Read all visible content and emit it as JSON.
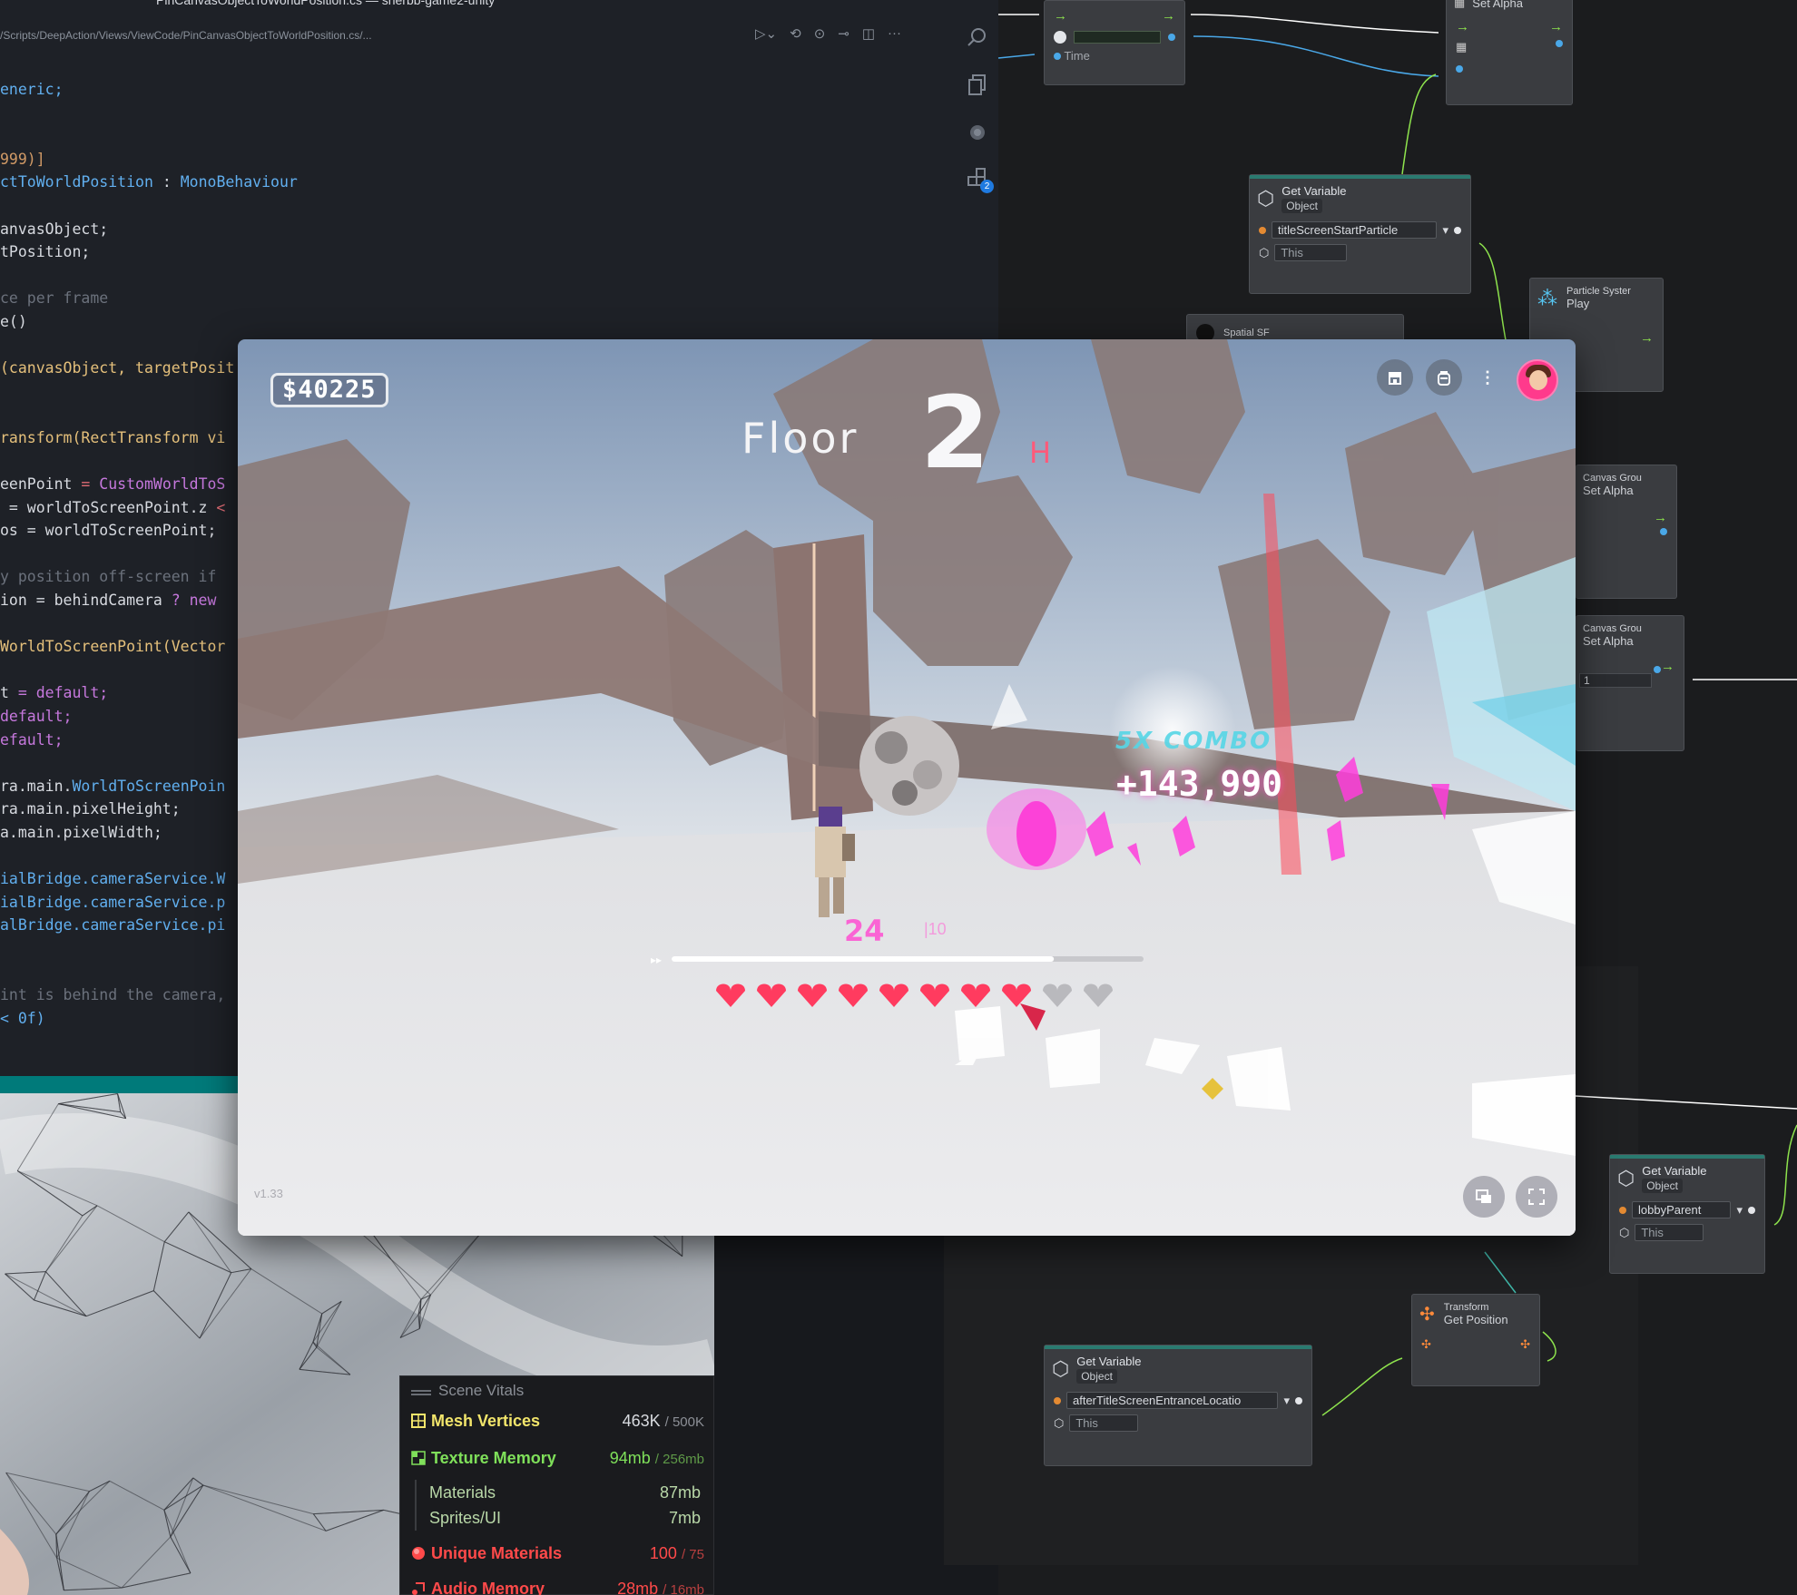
{
  "editor": {
    "title": "PinCanvasObjectToWorldPosition.cs — sherbb-game2-unity",
    "breadcrumb": "/Scripts/DeepAction/Views/ViewCode/PinCanvasObjectToWorldPosition.cs/...",
    "toolbar_icons": [
      "run-icon",
      "go-back-icon",
      "go-forward-icon",
      "compare-icon",
      "split-editor-icon",
      "more-icon"
    ],
    "activity_icons": [
      "search-icon",
      "copy-icon",
      "debug-icon",
      "extensions-icon"
    ],
    "extensions_badge": "2",
    "code_lines": [
      [
        {
          "t": "eneric;",
          "c": "ty"
        }
      ],
      [],
      [],
      [
        {
          "t": "999)]",
          "c": "nm"
        }
      ],
      [
        {
          "t": "ctToWorldPosition",
          "c": "ty"
        },
        {
          "t": " : ",
          "c": ""
        },
        {
          "t": "MonoBehaviour",
          "c": "ty"
        }
      ],
      [],
      [
        {
          "t": "anvasObject;",
          "c": ""
        }
      ],
      [
        {
          "t": "tPosition;",
          "c": ""
        }
      ],
      [],
      [
        {
          "t": "ce per frame",
          "c": "cm"
        }
      ],
      [
        {
          "t": "e()",
          "c": ""
        }
      ],
      [],
      [
        {
          "t": "(canvasObject, targetPosit",
          "c": "df"
        }
      ],
      [],
      [],
      [
        {
          "t": "ransform(RectTransform vi",
          "c": "df"
        }
      ],
      [],
      [
        {
          "t": "eenPoint",
          "c": ""
        },
        {
          "t": " = ",
          "c": "st"
        },
        {
          "t": "CustomWorldToS",
          "c": "kw"
        }
      ],
      [
        {
          "t": " = worldToScreenPoint.z",
          "c": ""
        },
        {
          "t": " < ",
          "c": "st"
        }
      ],
      [
        {
          "t": "os = worldToScreenPoint;",
          "c": ""
        }
      ],
      [],
      [
        {
          "t": "y position off-screen if",
          "c": "cm"
        }
      ],
      [
        {
          "t": "ion = behindCamera",
          "c": ""
        },
        {
          "t": " ? new ",
          "c": "kw"
        }
      ],
      [],
      [
        {
          "t": "WorldToScreenPoint(Vector",
          "c": "df"
        }
      ],
      [],
      [
        {
          "t": "t",
          "c": ""
        },
        {
          "t": " = default;",
          "c": "kw"
        }
      ],
      [
        {
          "t": "default;",
          "c": "kw"
        }
      ],
      [
        {
          "t": "efault;",
          "c": "kw"
        }
      ],
      [],
      [
        {
          "t": "ra.main.",
          "c": ""
        },
        {
          "t": "WorldToScreenPoin",
          "c": "ty"
        }
      ],
      [
        {
          "t": "ra.main.pixelHeight;",
          "c": ""
        }
      ],
      [
        {
          "t": "a.main.pixelWidth;",
          "c": ""
        }
      ],
      [],
      [
        {
          "t": "ialBridge.cameraService.W",
          "c": "ty"
        }
      ],
      [
        {
          "t": "ialBridge.cameraService.p",
          "c": "ty"
        }
      ],
      [
        {
          "t": "alBridge.cameraService.pi",
          "c": "ty"
        }
      ],
      [],
      [],
      [
        {
          "t": "int is behind the camera,",
          "c": "cm"
        }
      ],
      [
        {
          "t": "< 0f)",
          "c": "ty"
        }
      ]
    ]
  },
  "graph": {
    "time_node": {
      "label": "Time"
    },
    "set_alpha_top": {
      "title": "Set Alpha"
    },
    "get_variable_1": {
      "title": "Get Variable",
      "kind": "Object",
      "var_name": "titleScreenStartParticle",
      "target": "This"
    },
    "particle_node": {
      "title": "Particle Syster",
      "subtitle": "Play"
    },
    "spatial_node": {
      "title": "Spatial SF"
    },
    "canvas_group_1": {
      "title": "Canvas Grou",
      "subtitle": "Set Alpha"
    },
    "canvas_group_2": {
      "title": "Canvas Grou",
      "subtitle": "Set Alpha",
      "value": "1"
    },
    "get_variable_2": {
      "title": "Get Variable",
      "kind": "Object",
      "var_name": "lobbyParent",
      "target": "This"
    },
    "transform_node": {
      "title": "Transform",
      "subtitle": "Get Position"
    },
    "get_variable_3": {
      "title": "Get Variable",
      "kind": "Object",
      "var_name": "afterTitleScreenEntranceLocatio",
      "target": "This"
    }
  },
  "game": {
    "money": "$40225",
    "floor_label": "Floor",
    "floor_number": "2",
    "floor_suffix": "H",
    "combo": "5X COMBO",
    "score": "+143,990",
    "ammo": "24",
    "ammo_max": "|10",
    "version": "v1.33",
    "progress_fraction": 0.81,
    "hearts_full": 8,
    "hearts_total": 10,
    "hud_icons": [
      "shop-icon",
      "backpack-icon",
      "more-vertical-icon"
    ],
    "bottom_icons": [
      "chat-icon",
      "fullscreen-icon"
    ],
    "accent": "#ff3b5f"
  },
  "vitals": {
    "title": "Scene Vitals",
    "rows": [
      {
        "label": "Mesh Vertices",
        "value": "463K",
        "max": "/ 500K",
        "color": "#f2e56b"
      },
      {
        "label": "Texture Memory",
        "value": "94mb",
        "max": "/ 256mb",
        "color": "#7fe05a"
      },
      {
        "label": "Unique Materials",
        "value": "100",
        "max": "/ 75",
        "color": "#ff4a4a"
      },
      {
        "label": "Audio Memory",
        "value": "28mb",
        "max": "/ 16mb",
        "color": "#ff4a4a"
      }
    ],
    "sub_rows": [
      {
        "label": "Materials",
        "value": "87mb"
      },
      {
        "label": "Sprites/UI",
        "value": "7mb"
      }
    ]
  }
}
